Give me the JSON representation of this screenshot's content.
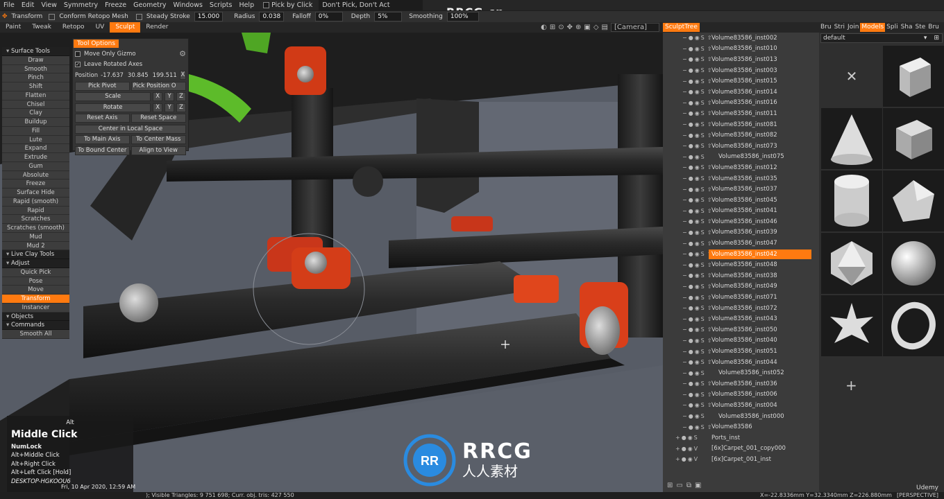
{
  "menu": {
    "items": [
      "File",
      "Edit",
      "View",
      "Symmetry",
      "Freeze",
      "Geometry",
      "Windows",
      "Scripts",
      "Help"
    ],
    "pick_by_click": "Pick by Click",
    "dont_pick": "Don't Pick, Don't Act"
  },
  "toolbar": {
    "transform": "Transform",
    "conform": "Conform Retopo Mesh",
    "steady": "Steady Stroke",
    "steady_val": "15.000",
    "radius": "Radius",
    "radius_val": "0.038",
    "falloff": "Falloff",
    "falloff_val": "0%",
    "depth": "Depth",
    "depth_val": "5%",
    "smoothing": "Smoothing",
    "smoothing_val": "100%"
  },
  "tabs": [
    {
      "label": "Paint"
    },
    {
      "label": "Tweak"
    },
    {
      "label": "Retopo"
    },
    {
      "label": "UV"
    },
    {
      "label": "Sculpt",
      "active": true
    },
    {
      "label": "Render"
    }
  ],
  "camera": "[Camera]",
  "watermark": "RRCG.cn",
  "left_panel": [
    {
      "label": "Surface Tools",
      "header": true
    },
    {
      "label": "Draw"
    },
    {
      "label": "Smooth"
    },
    {
      "label": "Pinch"
    },
    {
      "label": "Shift"
    },
    {
      "label": "Flatten"
    },
    {
      "label": "Chisel"
    },
    {
      "label": "Clay"
    },
    {
      "label": "Buildup"
    },
    {
      "label": "Fill"
    },
    {
      "label": "Lute"
    },
    {
      "label": "Expand"
    },
    {
      "label": "Extrude"
    },
    {
      "label": "Gum"
    },
    {
      "label": "Absolute"
    },
    {
      "label": "Freeze"
    },
    {
      "label": "Surface Hide"
    },
    {
      "label": "Rapid (smooth)"
    },
    {
      "label": "Rapid"
    },
    {
      "label": "Scratches"
    },
    {
      "label": "Scratches (smooth)"
    },
    {
      "label": "Mud"
    },
    {
      "label": "Mud 2"
    },
    {
      "label": "Live Clay Tools",
      "header": true
    },
    {
      "label": "Adjust",
      "header": true
    },
    {
      "label": "Quick Pick"
    },
    {
      "label": "Pose"
    },
    {
      "label": "Move"
    },
    {
      "label": "Transform",
      "active": true
    },
    {
      "label": "Instancer"
    },
    {
      "label": "Objects",
      "header": true
    },
    {
      "label": "Commands",
      "header": true
    },
    {
      "label": "Smooth All"
    }
  ],
  "tool_options": {
    "title": "Tool Options",
    "move_only_gizmo": "Move Only Gizmo",
    "leave_rotated": "Leave Rotated Axes",
    "position_label": "Position",
    "pos_x": "-17.637",
    "pos_y": "30.845",
    "pos_z": "199.511",
    "x": "X",
    "y": "Y",
    "z": "Z",
    "pick_pivot": "Pick Pivot",
    "pick_position": "Pick Position O",
    "scale": "Scale",
    "rotate": "Rotate",
    "reset_axis": "Reset Axis",
    "reset_space": "Reset Space",
    "center_local": "Center in Local Space",
    "to_main_axis": "To Main Axis",
    "to_center_mass": "To Center Mass",
    "to_bound_center": "To Bound Center",
    "align_to_view": "Align to View"
  },
  "hint": {
    "alt": "Alt",
    "title": "Middle Click",
    "lines": [
      "NumLock",
      "Alt+Middle Click",
      "Alt+Right Click",
      "Alt+Left Click [Hold]",
      "DESKTOP-HGKOOU6"
    ],
    "datetime": "Fri, 10 Apr 2020, 12:59 AM"
  },
  "status": {
    "text": "); Visible Triangles: 9 751 698; Curr. obj. tris: 427 550",
    "coords": "X=-22.8336mm Y=32.3340mm Z=226.880mm",
    "view": "[PERSPECTIVE]"
  },
  "sculpt_tree": {
    "title": "SculptTree",
    "rows": [
      {
        "label": "Volume83586_inst002"
      },
      {
        "label": "Volume83586_inst010"
      },
      {
        "label": "Volume83586_inst013"
      },
      {
        "label": "Volume83586_inst003"
      },
      {
        "label": "Volume83586_inst015"
      },
      {
        "label": "Volume83586_inst014"
      },
      {
        "label": "Volume83586_inst016"
      },
      {
        "label": "Volume83586_inst011"
      },
      {
        "label": "Volume83586_inst081"
      },
      {
        "label": "Volume83586_inst082"
      },
      {
        "label": "Volume83586_inst073"
      },
      {
        "label": "Volume83586_inst075"
      },
      {
        "label": "Volume83586_inst012"
      },
      {
        "label": "Volume83586_inst035"
      },
      {
        "label": "Volume83586_inst037"
      },
      {
        "label": "Volume83586_inst045"
      },
      {
        "label": "Volume83586_inst041"
      },
      {
        "label": "Volume83586_inst046"
      },
      {
        "label": "Volume83586_inst039"
      },
      {
        "label": "Volume83586_inst047"
      },
      {
        "label": "Volume83586_inst042",
        "selected": true
      },
      {
        "label": "Volume83586_inst048"
      },
      {
        "label": "Volume83586_inst038"
      },
      {
        "label": "Volume83586_inst049"
      },
      {
        "label": "Volume83586_inst071"
      },
      {
        "label": "Volume83586_inst072"
      },
      {
        "label": "Volume83586_inst043"
      },
      {
        "label": "Volume83586_inst050"
      },
      {
        "label": "Volume83586_inst040"
      },
      {
        "label": "Volume83586_inst051"
      },
      {
        "label": "Volume83586_inst044"
      },
      {
        "label": "Volume83586_inst052"
      },
      {
        "label": "Volume83586_inst036"
      },
      {
        "label": "Volume83586_inst006"
      },
      {
        "label": "Volume83586_inst004"
      },
      {
        "label": "Volume83586_inst000"
      },
      {
        "label": "Volume83586"
      },
      {
        "label": "Ports_inst"
      },
      {
        "label": "[6x]Carpet_001_copy000"
      },
      {
        "label": "[6x]Carpet_001_inst"
      }
    ]
  },
  "right_panel": {
    "tabs": [
      "Bru",
      "Stri",
      "Join",
      "Models",
      "Spli",
      "Sha",
      "Ste",
      "Bru"
    ],
    "active_tab": "Models",
    "preset": "default"
  },
  "logo": {
    "name": "RRCG",
    "sub": "人人素材"
  },
  "udemy": "Udemy"
}
